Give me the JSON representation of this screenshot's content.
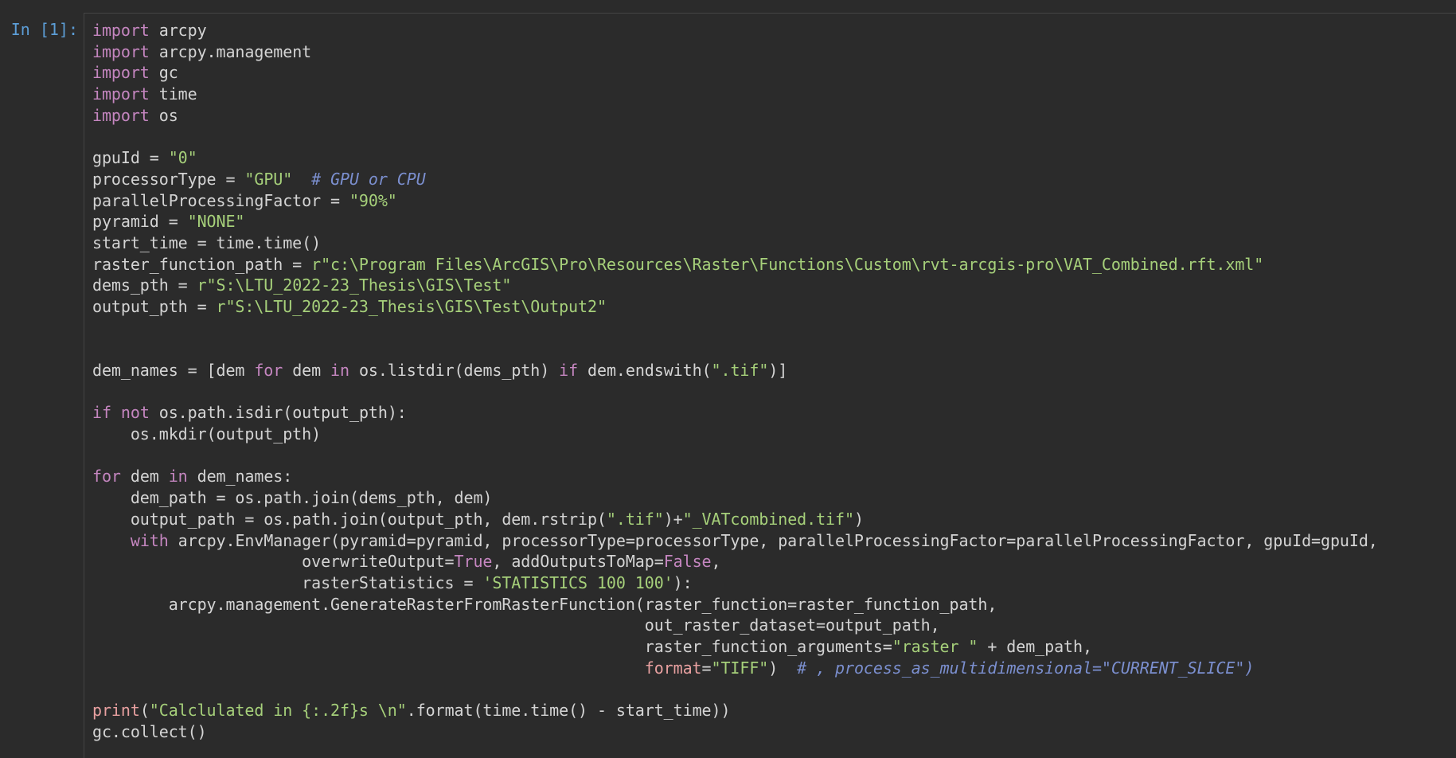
{
  "cell": {
    "prompt": "In [1]:",
    "lines": [
      [
        {
          "t": "import",
          "c": "kw"
        },
        {
          "t": " arcpy"
        }
      ],
      [
        {
          "t": "import",
          "c": "kw"
        },
        {
          "t": " arcpy.management"
        }
      ],
      [
        {
          "t": "import",
          "c": "kw"
        },
        {
          "t": " gc"
        }
      ],
      [
        {
          "t": "import",
          "c": "kw"
        },
        {
          "t": " time"
        }
      ],
      [
        {
          "t": "import",
          "c": "kw"
        },
        {
          "t": " os"
        }
      ],
      [],
      [
        {
          "t": "gpuId = "
        },
        {
          "t": "\"0\"",
          "c": "str"
        }
      ],
      [
        {
          "t": "processorType = "
        },
        {
          "t": "\"GPU\"",
          "c": "str"
        },
        {
          "t": "  "
        },
        {
          "t": "# GPU or CPU",
          "c": "cmt"
        }
      ],
      [
        {
          "t": "parallelProcessingFactor = "
        },
        {
          "t": "\"90%\"",
          "c": "str"
        }
      ],
      [
        {
          "t": "pyramid = "
        },
        {
          "t": "\"NONE\"",
          "c": "str"
        }
      ],
      [
        {
          "t": "start_time = time.time()"
        }
      ],
      [
        {
          "t": "raster_function_path = "
        },
        {
          "t": "r\"c:\\Program Files\\ArcGIS\\Pro\\Resources\\Raster\\Functions\\Custom\\rvt-arcgis-pro\\VAT_Combined.rft.xml\"",
          "c": "str"
        }
      ],
      [
        {
          "t": "dems_pth = "
        },
        {
          "t": "r\"S:\\LTU_2022-23_Thesis\\GIS\\Test\"",
          "c": "str"
        }
      ],
      [
        {
          "t": "output_pth = "
        },
        {
          "t": "r\"S:\\LTU_2022-23_Thesis\\GIS\\Test\\Output2\"",
          "c": "str"
        }
      ],
      [],
      [],
      [
        {
          "t": "dem_names = [dem "
        },
        {
          "t": "for",
          "c": "kw"
        },
        {
          "t": " dem "
        },
        {
          "t": "in",
          "c": "kw"
        },
        {
          "t": " os.listdir(dems_pth) "
        },
        {
          "t": "if",
          "c": "kw"
        },
        {
          "t": " dem.endswith("
        },
        {
          "t": "\".tif\"",
          "c": "str"
        },
        {
          "t": ")]"
        }
      ],
      [],
      [
        {
          "t": "if",
          "c": "kw"
        },
        {
          "t": " "
        },
        {
          "t": "not",
          "c": "kw"
        },
        {
          "t": " os.path.isdir(output_pth):"
        }
      ],
      [
        {
          "t": "    os.mkdir(output_pth)"
        }
      ],
      [],
      [
        {
          "t": "for",
          "c": "kw"
        },
        {
          "t": " dem "
        },
        {
          "t": "in",
          "c": "kw"
        },
        {
          "t": " dem_names:"
        }
      ],
      [
        {
          "t": "    dem_path = os.path.join(dems_pth, dem)"
        }
      ],
      [
        {
          "t": "    output_path = os.path.join(output_pth, dem.rstrip("
        },
        {
          "t": "\".tif\"",
          "c": "str"
        },
        {
          "t": ")+"
        },
        {
          "t": "\"_VATcombined.tif\"",
          "c": "str"
        },
        {
          "t": ")"
        }
      ],
      [
        {
          "t": "    "
        },
        {
          "t": "with",
          "c": "kw"
        },
        {
          "t": " arcpy.EnvManager(pyramid=pyramid, processorType=processorType, parallelProcessingFactor=parallelProcessingFactor, gpuId=gpuId,"
        }
      ],
      [
        {
          "t": "                      overwriteOutput="
        },
        {
          "t": "True",
          "c": "boolc"
        },
        {
          "t": ", addOutputsToMap="
        },
        {
          "t": "False",
          "c": "boolc"
        },
        {
          "t": ","
        }
      ],
      [
        {
          "t": "                      rasterStatistics = "
        },
        {
          "t": "'STATISTICS 100 100'",
          "c": "str"
        },
        {
          "t": "):"
        }
      ],
      [
        {
          "t": "        arcpy.management.GenerateRasterFromRasterFunction(raster_function=raster_function_path,"
        }
      ],
      [
        {
          "t": "                                                          out_raster_dataset=output_path,"
        }
      ],
      [
        {
          "t": "                                                          raster_function_arguments="
        },
        {
          "t": "\"raster \"",
          "c": "str"
        },
        {
          "t": " + dem_path,"
        }
      ],
      [
        {
          "t": "                                                          "
        },
        {
          "t": "format",
          "c": "bi"
        },
        {
          "t": "="
        },
        {
          "t": "\"TIFF\"",
          "c": "str"
        },
        {
          "t": ")  "
        },
        {
          "t": "# , process_as_multidimensional=\"CURRENT_SLICE\")",
          "c": "cmt"
        }
      ],
      [],
      [
        {
          "t": "print",
          "c": "bi"
        },
        {
          "t": "("
        },
        {
          "t": "\"Calclulated in {:.2f}s \\n\"",
          "c": "str"
        },
        {
          "t": ".format(time.time() - start_time))"
        }
      ],
      [
        {
          "t": "gc.collect()"
        }
      ]
    ]
  }
}
